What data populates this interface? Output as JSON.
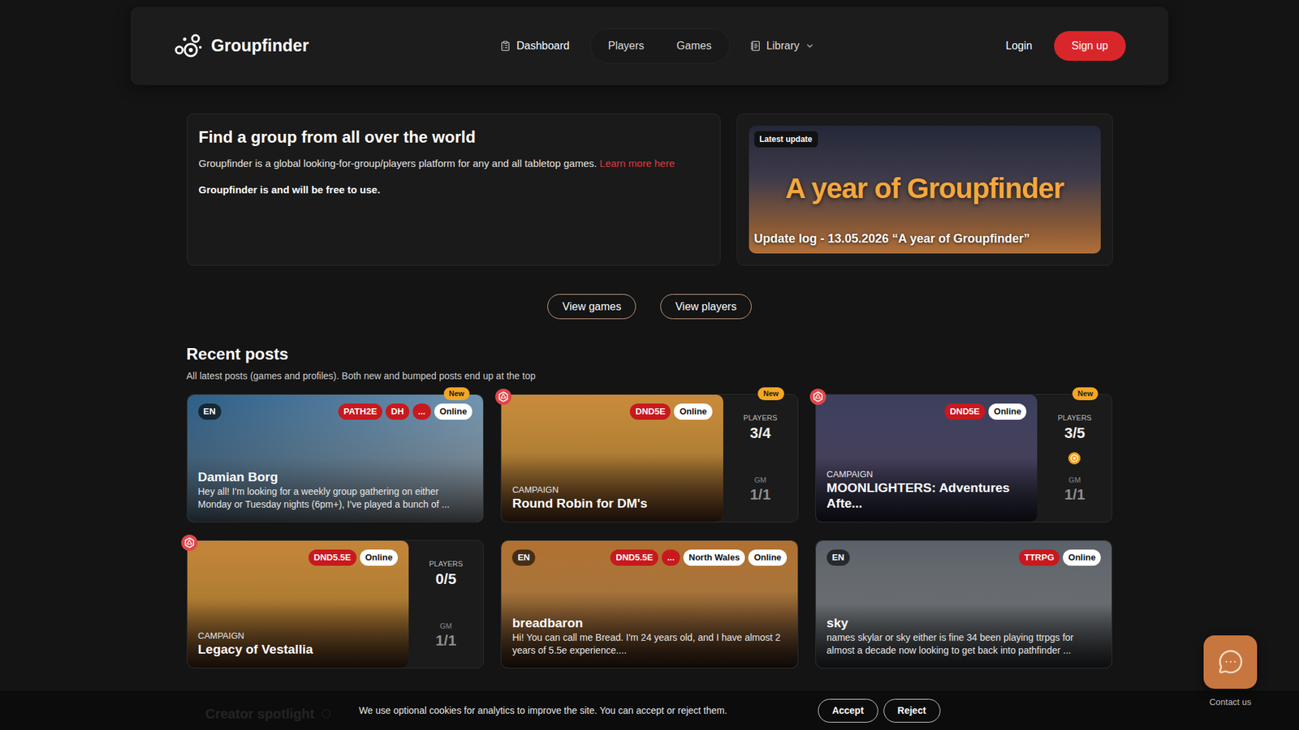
{
  "nav": {
    "brand": "Groupfinder",
    "items": [
      {
        "label": "Dashboard",
        "kind": "icon"
      },
      {
        "label": "Players",
        "kind": "grouped"
      },
      {
        "label": "Games",
        "kind": "grouped"
      },
      {
        "label": "Library",
        "kind": "dropdown"
      }
    ],
    "login": "Login",
    "signup": "Sign up"
  },
  "intro": {
    "title": "Find a group from all over the world",
    "text": "Groupfinder is a global looking-for-group/players platform for any and all tabletop games.",
    "link": "Learn more here",
    "note": "Groupfinder is and will be free to use."
  },
  "update": {
    "badge": "Latest update",
    "banner": "A year of Groupfinder",
    "caption": "Update log - 13.05.2026 “A year of Groupfinder”"
  },
  "actions": [
    "View games",
    "View players"
  ],
  "recent": {
    "title": "Recent posts",
    "subtitle": "All latest posts (games and profiles). Both new and bumped posts end up at the top"
  },
  "new_label": "New",
  "posts": [
    {
      "kind": "profile",
      "new": true,
      "d20": false,
      "lang": "EN",
      "tags": [
        {
          "label": "PATH2E",
          "color": "#c8191e"
        },
        {
          "label": "DH",
          "color": "#c8191e"
        },
        {
          "label": "...",
          "color": "#c8191e"
        },
        {
          "label": "Online",
          "color": "#ffffff"
        }
      ],
      "name": "Damian Borg",
      "text": "Hey all! I'm looking for a weekly group gathering on either Monday or Tuesday nights (6pm+), I've played a bunch of ..."
    },
    {
      "kind": "campaign",
      "new": true,
      "d20": true,
      "coin": false,
      "tags": [
        {
          "label": "DND5E",
          "color": "#c8191e"
        },
        {
          "label": "Online",
          "color": "#ffffff"
        }
      ],
      "type": "CAMPAIGN",
      "title": "Round Robin for DM's",
      "players_label": "PLAYERS",
      "players": "3/4",
      "gm_label": "GM",
      "gm": "1/1"
    },
    {
      "kind": "campaign",
      "new": true,
      "d20": true,
      "coin": true,
      "tags": [
        {
          "label": "DND5E",
          "color": "#c8191e"
        },
        {
          "label": "Online",
          "color": "#ffffff"
        }
      ],
      "type": "CAMPAIGN",
      "title": "MOONLIGHTERS: Adventures Afte...",
      "players_label": "PLAYERS",
      "players": "3/5",
      "gm_label": "GM",
      "gm": "1/1"
    },
    {
      "kind": "campaign",
      "new": false,
      "d20": true,
      "coin": false,
      "tags": [
        {
          "label": "DND5.5E",
          "color": "#c8191e"
        },
        {
          "label": "Online",
          "color": "#ffffff"
        }
      ],
      "type": "CAMPAIGN",
      "title": "Legacy of Vestallia",
      "players_label": "PLAYERS",
      "players": "0/5",
      "gm_label": "GM",
      "gm": "1/1"
    },
    {
      "kind": "profile",
      "new": false,
      "d20": false,
      "lang": "EN",
      "tags": [
        {
          "label": "DND5.5E",
          "color": "#c8191e"
        },
        {
          "label": "...",
          "color": "#c8191e"
        },
        {
          "label": "North Wales",
          "color": "#ffffff"
        },
        {
          "label": "Online",
          "color": "#ffffff"
        }
      ],
      "name": "breadbaron",
      "text": "Hi! You can call me Bread. I'm 24 years old, and I have almost 2 years of 5.5e experience...."
    },
    {
      "kind": "profile",
      "new": false,
      "d20": false,
      "lang": "EN",
      "tags": [
        {
          "label": "TTRPG",
          "color": "#c8191e"
        },
        {
          "label": "Online",
          "color": "#ffffff"
        }
      ],
      "name": "sky",
      "text": "names skylar or sky either is fine 34 been playing ttrpgs for almost a decade now looking to get back into pathfinder ..."
    }
  ],
  "spotlight": "Creator spotlight",
  "cookie": {
    "text": "We use optional cookies for analytics to improve the site. You can accept or reject them.",
    "accept": "Accept",
    "reject": "Reject"
  },
  "contact": "Contact us"
}
